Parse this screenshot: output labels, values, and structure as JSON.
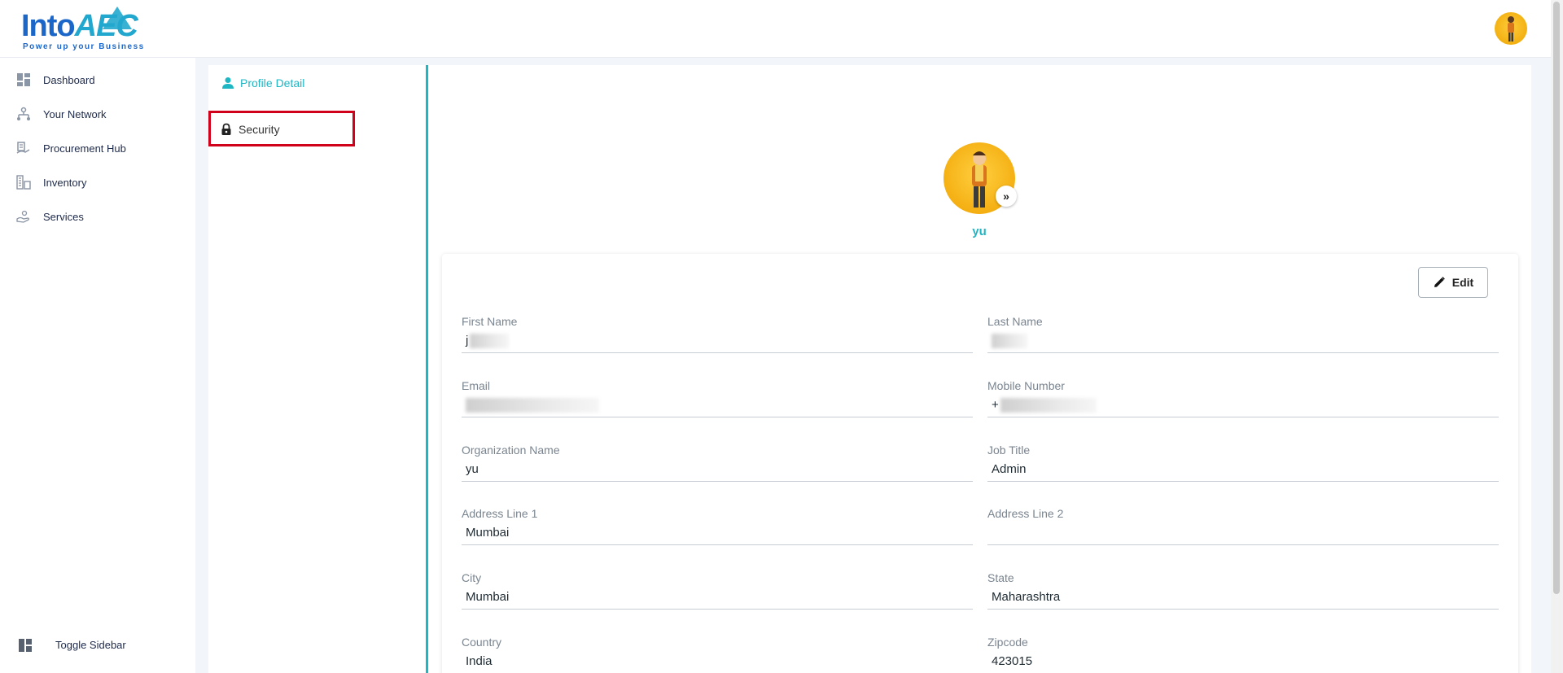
{
  "brand": {
    "logo_text_part1": "Into",
    "logo_text_part2": "AEC",
    "tagline": "Power up your Business"
  },
  "sidebar": {
    "items": [
      {
        "label": "Dashboard",
        "icon": "dashboard-icon"
      },
      {
        "label": "Your Network",
        "icon": "network-icon"
      },
      {
        "label": "Procurement Hub",
        "icon": "procurement-icon"
      },
      {
        "label": "Inventory",
        "icon": "inventory-icon"
      },
      {
        "label": "Services",
        "icon": "services-icon"
      }
    ],
    "toggle_label": "Toggle Sidebar"
  },
  "tabs": [
    {
      "label": "Profile Detail",
      "icon": "user-icon",
      "active": true
    },
    {
      "label": "Security",
      "icon": "lock-icon",
      "active": false
    }
  ],
  "profile": {
    "name": "yu",
    "edit_label": "Edit",
    "fields": {
      "first_name": {
        "label": "First Name",
        "value": "j"
      },
      "last_name": {
        "label": "Last Name",
        "value": ""
      },
      "email": {
        "label": "Email",
        "value": ""
      },
      "mobile": {
        "label": "Mobile Number",
        "value": "+"
      },
      "organization": {
        "label": "Organization Name",
        "value": "yu"
      },
      "job_title": {
        "label": "Job Title",
        "value": "Admin"
      },
      "address1": {
        "label": "Address Line 1",
        "value": "Mumbai"
      },
      "address2": {
        "label": "Address Line 2",
        "value": ""
      },
      "city": {
        "label": "City",
        "value": "Mumbai"
      },
      "state": {
        "label": "State",
        "value": "Maharashtra"
      },
      "country": {
        "label": "Country",
        "value": "India"
      },
      "zipcode": {
        "label": "Zipcode",
        "value": "423015"
      }
    }
  },
  "colors": {
    "brand_blue": "#1b67c9",
    "accent_teal": "#1fb6c4",
    "highlight_red": "#d0021b",
    "avatar_yellow": "#f0a200"
  }
}
